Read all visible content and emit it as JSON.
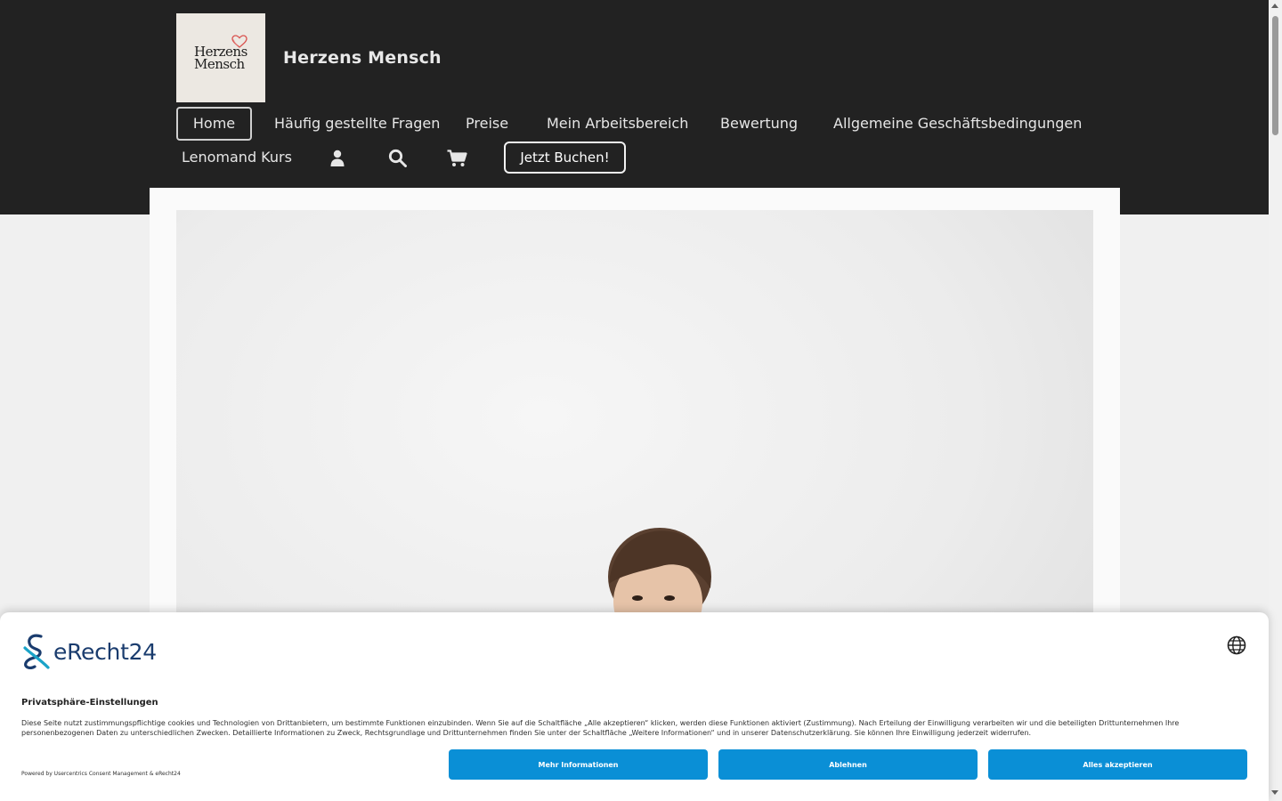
{
  "site": {
    "logo_line1": "Herzens",
    "logo_line2": "Mensch",
    "title": "Herzens Mensch"
  },
  "nav": {
    "home": "Home",
    "faq": "Häufig gestellte Fragen",
    "prices": "Preise",
    "workspace": "Mein Arbeitsbereich",
    "review": "Bewertung",
    "terms": "Allgemeine Geschäftsbedingungen",
    "course": "Lenomand Kurs",
    "book_now": "Jetzt Buchen!"
  },
  "icons": {
    "account": "user-icon",
    "search": "search-icon",
    "cart": "cart-icon",
    "language": "globe-icon"
  },
  "consent": {
    "brand": "eRecht24",
    "title": "Privatsphäre-Einstellungen",
    "text": "Diese Seite nutzt zustimmungspflichtige cookies und Technologien von Drittanbietern, um bestimmte Funktionen einzubinden. Wenn Sie auf die Schaltfläche „Alle akzeptieren“ klicken, werden diese Funktionen aktiviert (Zustimmung). Nach Erteilung der Einwilligung verarbeiten wir und die beteiligten Drittunternehmen Ihre personenbezogenen Daten zu unterschiedlichen Zwecken. Detaillierte Informationen zu Zweck, Rechtsgrundlage und Drittunternehmen finden Sie unter der Schaltfläche „Weitere Informationen“ und in unserer Datenschutzerklärung. Sie können Ihre Einwilligung jederzeit widerrufen.",
    "powered_by": "Powered by Usercentrics Consent Management & eRecht24",
    "more_info": "Mehr Informationen",
    "decline": "Ablehnen",
    "accept_all": "Alles akzeptieren"
  },
  "colors": {
    "header_bg": "#222222",
    "button_blue": "#0a8fd6",
    "brand_dark": "#1a3c6e",
    "brand_teal": "#1aa3c8",
    "heart_red": "#d9534f"
  }
}
